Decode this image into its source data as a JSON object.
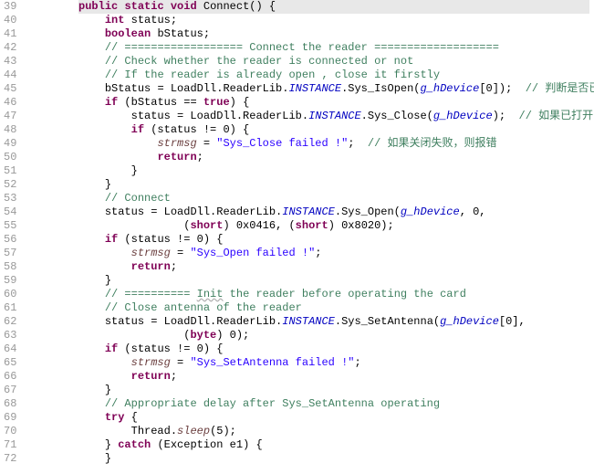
{
  "lines": [
    {
      "n": 39,
      "indent": 2,
      "type": "method_decl",
      "parts": [
        {
          "t": "public",
          "c": "kw"
        },
        {
          "t": " "
        },
        {
          "t": "static",
          "c": "kw"
        },
        {
          "t": " "
        },
        {
          "t": "void",
          "c": "kw"
        },
        {
          "t": " Connect() {"
        }
      ]
    },
    {
      "n": 40,
      "indent": 3,
      "parts": [
        {
          "t": "int",
          "c": "kw"
        },
        {
          "t": " status;"
        }
      ]
    },
    {
      "n": 41,
      "indent": 3,
      "parts": [
        {
          "t": "boolean",
          "c": "kw"
        },
        {
          "t": " bStatus;"
        }
      ]
    },
    {
      "n": 42,
      "indent": 3,
      "parts": [
        {
          "t": "// ================== Connect the reader ===================",
          "c": "com"
        }
      ]
    },
    {
      "n": 43,
      "indent": 3,
      "parts": [
        {
          "t": "// Check whether the reader is connected or not",
          "c": "com"
        }
      ]
    },
    {
      "n": 44,
      "indent": 3,
      "parts": [
        {
          "t": "// If the reader is already open , close it firstly",
          "c": "com"
        }
      ]
    },
    {
      "n": 45,
      "indent": 3,
      "parts": [
        {
          "t": "bStatus = LoadDll.ReaderLib."
        },
        {
          "t": "INSTANCE",
          "c": "fld"
        },
        {
          "t": ".Sys_IsOpen("
        },
        {
          "t": "g_hDevice",
          "c": "fld"
        },
        {
          "t": "[0]);  "
        },
        {
          "t": "// 判断是否已打开?",
          "c": "com"
        }
      ]
    },
    {
      "n": 46,
      "indent": 3,
      "parts": [
        {
          "t": "if",
          "c": "kw"
        },
        {
          "t": " (bStatus == "
        },
        {
          "t": "true",
          "c": "kw"
        },
        {
          "t": ") {"
        }
      ]
    },
    {
      "n": 47,
      "indent": 4,
      "parts": [
        {
          "t": "status = LoadDll.ReaderLib."
        },
        {
          "t": "INSTANCE",
          "c": "fld"
        },
        {
          "t": ".Sys_Close("
        },
        {
          "t": "g_hDevice",
          "c": "fld"
        },
        {
          "t": ");  "
        },
        {
          "t": "// 如果已打开，则先关闭",
          "c": "com"
        }
      ]
    },
    {
      "n": 48,
      "indent": 4,
      "parts": [
        {
          "t": "if",
          "c": "kw"
        },
        {
          "t": " (status != 0) {"
        }
      ]
    },
    {
      "n": 49,
      "indent": 5,
      "parts": [
        {
          "t": "strmsg",
          "c": "var"
        },
        {
          "t": " = "
        },
        {
          "t": "\"Sys_Close failed !\"",
          "c": "str"
        },
        {
          "t": ";  "
        },
        {
          "t": "// 如果关闭失败，则报错",
          "c": "com"
        }
      ]
    },
    {
      "n": 50,
      "indent": 5,
      "parts": [
        {
          "t": "return",
          "c": "kw"
        },
        {
          "t": ";"
        }
      ]
    },
    {
      "n": 51,
      "indent": 4,
      "parts": [
        {
          "t": "}"
        }
      ]
    },
    {
      "n": 52,
      "indent": 3,
      "parts": [
        {
          "t": "}"
        }
      ]
    },
    {
      "n": 53,
      "indent": 3,
      "parts": [
        {
          "t": "// Connect",
          "c": "com"
        }
      ]
    },
    {
      "n": 54,
      "indent": 3,
      "parts": [
        {
          "t": "status = LoadDll.ReaderLib."
        },
        {
          "t": "INSTANCE",
          "c": "fld"
        },
        {
          "t": ".Sys_Open("
        },
        {
          "t": "g_hDevice",
          "c": "fld"
        },
        {
          "t": ", 0,"
        }
      ]
    },
    {
      "n": 55,
      "indent": 6,
      "parts": [
        {
          "t": "("
        },
        {
          "t": "short",
          "c": "kw"
        },
        {
          "t": ") 0x0416, ("
        },
        {
          "t": "short",
          "c": "kw"
        },
        {
          "t": ") 0x8020);"
        }
      ]
    },
    {
      "n": 56,
      "indent": 3,
      "parts": [
        {
          "t": "if",
          "c": "kw"
        },
        {
          "t": " (status != 0) {"
        }
      ]
    },
    {
      "n": 57,
      "indent": 4,
      "parts": [
        {
          "t": "strmsg",
          "c": "var"
        },
        {
          "t": " = "
        },
        {
          "t": "\"Sys_Open failed !\"",
          "c": "str"
        },
        {
          "t": ";"
        }
      ]
    },
    {
      "n": 58,
      "indent": 4,
      "parts": [
        {
          "t": "return",
          "c": "kw"
        },
        {
          "t": ";"
        }
      ]
    },
    {
      "n": 59,
      "indent": 3,
      "parts": [
        {
          "t": "}"
        }
      ]
    },
    {
      "n": 60,
      "indent": 3,
      "parts": [
        {
          "t": "// ========== ",
          "c": "com"
        },
        {
          "t": "Init",
          "c": "com squiggle"
        },
        {
          "t": " the reader before operating the card",
          "c": "com"
        }
      ]
    },
    {
      "n": 61,
      "indent": 3,
      "parts": [
        {
          "t": "// Close antenna of the reader",
          "c": "com"
        }
      ]
    },
    {
      "n": 62,
      "indent": 3,
      "parts": [
        {
          "t": "status = LoadDll.ReaderLib."
        },
        {
          "t": "INSTANCE",
          "c": "fld"
        },
        {
          "t": ".Sys_SetAntenna("
        },
        {
          "t": "g_hDevice",
          "c": "fld"
        },
        {
          "t": "[0],"
        }
      ]
    },
    {
      "n": 63,
      "indent": 6,
      "parts": [
        {
          "t": "("
        },
        {
          "t": "byte",
          "c": "kw"
        },
        {
          "t": ") 0);"
        }
      ]
    },
    {
      "n": 64,
      "indent": 3,
      "parts": [
        {
          "t": "if",
          "c": "kw"
        },
        {
          "t": " (status != 0) {"
        }
      ]
    },
    {
      "n": 65,
      "indent": 4,
      "parts": [
        {
          "t": "strmsg",
          "c": "var"
        },
        {
          "t": " = "
        },
        {
          "t": "\"Sys_SetAntenna failed !\"",
          "c": "str"
        },
        {
          "t": ";"
        }
      ]
    },
    {
      "n": 66,
      "indent": 4,
      "parts": [
        {
          "t": "return",
          "c": "kw"
        },
        {
          "t": ";"
        }
      ]
    },
    {
      "n": 67,
      "indent": 3,
      "parts": [
        {
          "t": "}"
        }
      ]
    },
    {
      "n": 68,
      "indent": 3,
      "parts": [
        {
          "t": "// Appropriate delay after Sys_SetAntenna operating",
          "c": "com"
        }
      ]
    },
    {
      "n": 69,
      "indent": 3,
      "parts": [
        {
          "t": "try",
          "c": "kw"
        },
        {
          "t": " {"
        }
      ]
    },
    {
      "n": 70,
      "indent": 4,
      "parts": [
        {
          "t": "Thread."
        },
        {
          "t": "sleep",
          "c": "var"
        },
        {
          "t": "(5);"
        }
      ]
    },
    {
      "n": 71,
      "indent": 3,
      "parts": [
        {
          "t": "} "
        },
        {
          "t": "catch",
          "c": "kw"
        },
        {
          "t": " (Exception e1) {"
        }
      ]
    },
    {
      "n": 72,
      "indent": 3,
      "parts": [
        {
          "t": "}"
        }
      ]
    }
  ]
}
